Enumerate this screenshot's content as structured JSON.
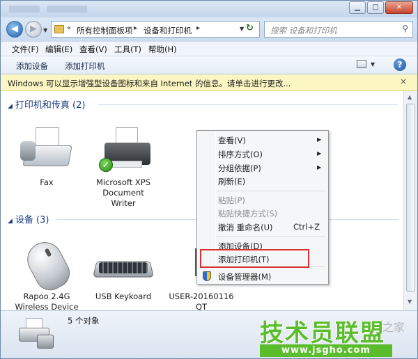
{
  "address": {
    "crumbs": [
      "所有控制面板项",
      "设备和打印机"
    ],
    "nav_prefix": "«"
  },
  "search": {
    "placeholder": "搜索 设备和打印机"
  },
  "menubar": [
    "文件(F)",
    "编辑(E)",
    "查看(V)",
    "工具(T)",
    "帮助(H)"
  ],
  "toolbar": {
    "add_device": "添加设备",
    "add_printer": "添加打印机"
  },
  "infobar": {
    "text": "Windows 可以显示增强型设备图标和来自 Internet 的信息。请单击进行更改...",
    "close": "×"
  },
  "groups": {
    "printers": {
      "title": "打印机和传真 (2)",
      "items": [
        "Fax",
        "Microsoft XPS Document Writer"
      ]
    },
    "devices": {
      "title": "设备 (3)",
      "items": [
        "Rapoo 2.4G Wireless Device",
        "USB Keykoard",
        "USER-20160116 QT"
      ]
    }
  },
  "context_menu": {
    "view": "查看(V)",
    "sort": "排序方式(O)",
    "group": "分组依据(P)",
    "refresh": "刷新(E)",
    "paste": "粘贴(P)",
    "paste_shortcut": "粘贴快捷方式(S)",
    "undo_rename": "撤消 重命名(U)",
    "undo_shortcut": "Ctrl+Z",
    "add_device": "添加设备(D)",
    "add_printer": "添加打印机(T)",
    "device_manager": "设备管理器(M)"
  },
  "footer": {
    "count": "5 个对象"
  },
  "watermark": {
    "main": "技术员联盟",
    "side": "之家",
    "url": "www.jsgho.com"
  },
  "colors": {
    "group_header": "#1b3c82",
    "info_bg": "#fcf6c2",
    "highlight": "#d93232",
    "watermark": "#5bbd2c"
  }
}
